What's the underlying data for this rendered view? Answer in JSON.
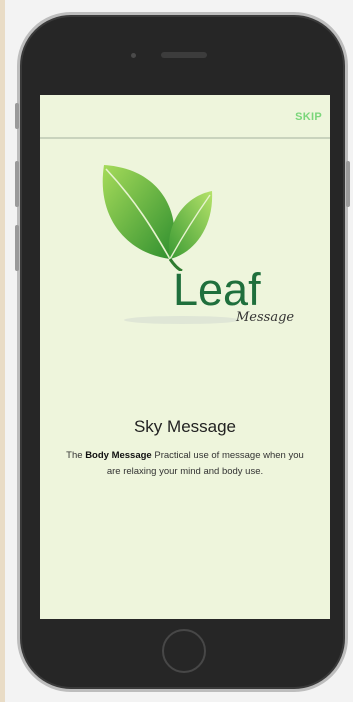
{
  "topbar": {
    "skip_label": "SKIP"
  },
  "logo": {
    "word": "Leaf",
    "sub": "Message"
  },
  "intro": {
    "title": "Sky Message",
    "desc_prefix": "The ",
    "desc_bold": "Body Message",
    "desc_rest": " Practical use of message when you are relaxing your mind and body use."
  },
  "colors": {
    "screen_bg": "#eef5dc",
    "skip": "#7ad67a",
    "leaf_dark": "#2e8b2e",
    "leaf_light": "#8fd14f",
    "logo_text": "#1f6f3c"
  }
}
